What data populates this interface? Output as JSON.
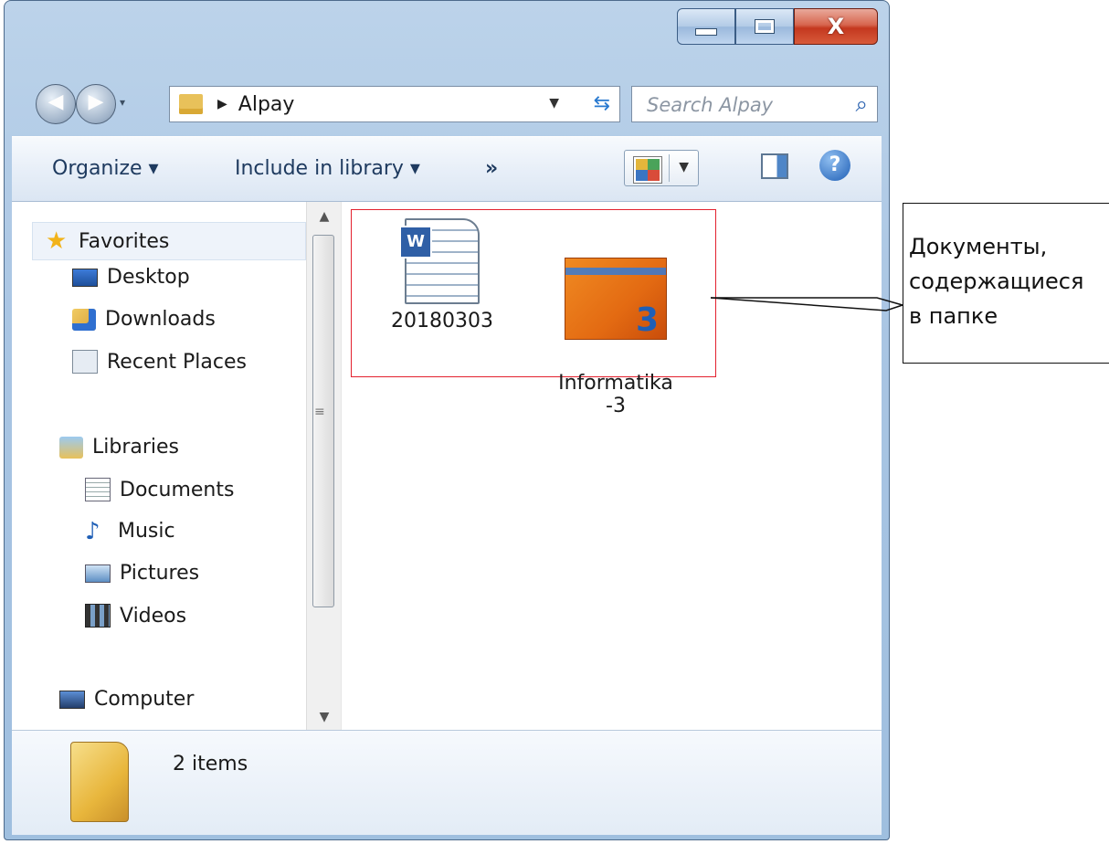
{
  "window": {
    "controls": {
      "minimize_icon": "minimize-icon",
      "maximize_icon": "maximize-icon",
      "close_icon": "close-icon",
      "close_glyph": "X"
    }
  },
  "navbar": {
    "address_path": "Alpay",
    "search_placeholder": "Search Alpay"
  },
  "toolbar": {
    "organize_label": "Organize ▾",
    "include_label": "Include in library ▾",
    "more_label": "»"
  },
  "sidebar": {
    "items": [
      {
        "label": "Favorites",
        "icon": "star-icon"
      },
      {
        "label": "Desktop",
        "icon": "desktop-icon"
      },
      {
        "label": "Downloads",
        "icon": "downloads-icon"
      },
      {
        "label": "Recent Places",
        "icon": "recent-places-icon"
      },
      {
        "label": "Libraries",
        "icon": "libraries-icon"
      },
      {
        "label": "Documents",
        "icon": "documents-icon"
      },
      {
        "label": "Music",
        "icon": "music-icon"
      },
      {
        "label": "Pictures",
        "icon": "pictures-icon"
      },
      {
        "label": "Videos",
        "icon": "videos-icon"
      },
      {
        "label": "Computer",
        "icon": "computer-icon"
      }
    ]
  },
  "files": [
    {
      "name": "20180303",
      "icon": "word-document-icon"
    },
    {
      "name": "Informatika\n-3",
      "icon": "book-cover-icon"
    }
  ],
  "status": {
    "count_text": "2 items"
  },
  "callout": {
    "text": "Документы,\nсодержащиеся\nв папке"
  },
  "colors": {
    "selection_border": "#e3212e",
    "titlebar": "#a9c5e3"
  }
}
